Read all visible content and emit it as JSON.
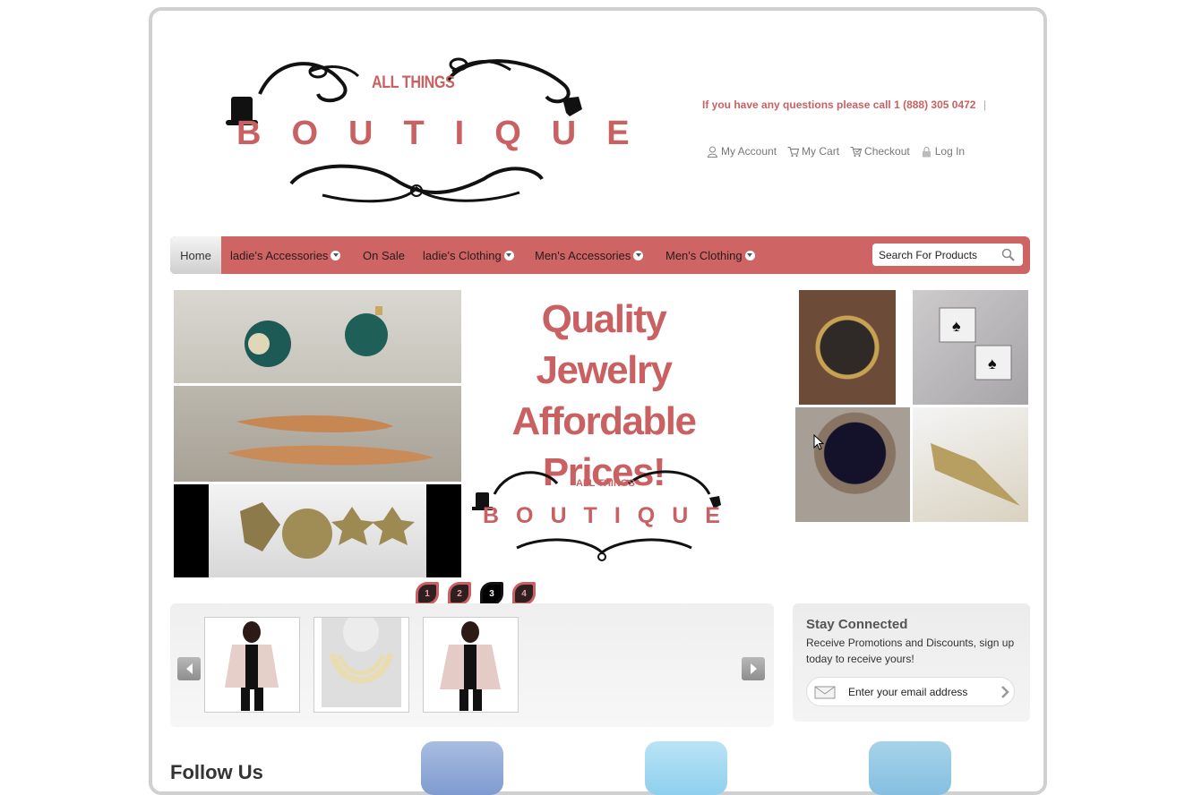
{
  "logo": {
    "small_text": "ALL THINGS",
    "big_text": "BOUTIQUE"
  },
  "header": {
    "phone_text": "If you have any questions please call 1 (888) 305 0472",
    "separator": "|",
    "links": [
      {
        "label": "My Account",
        "icon": "user-icon"
      },
      {
        "label": "My Cart",
        "icon": "cart-icon"
      },
      {
        "label": "Checkout",
        "icon": "checkout-icon"
      },
      {
        "label": "Log In",
        "icon": "lock-icon"
      }
    ]
  },
  "nav": {
    "items": [
      {
        "label": "Home",
        "dropdown": false
      },
      {
        "label": "ladie's Accessories",
        "dropdown": true
      },
      {
        "label": "On Sale",
        "dropdown": false
      },
      {
        "label": "ladie's Clothing",
        "dropdown": true
      },
      {
        "label": "Men's Accessories",
        "dropdown": true
      },
      {
        "label": "Men's Clothing",
        "dropdown": true
      }
    ],
    "search_placeholder": "Search For Products"
  },
  "slider": {
    "headline_lines": [
      "Quality Jewelry",
      "Affordable",
      "Prices!"
    ],
    "logo_small": "ALL THINGS",
    "logo_big": "BOUTIQUE",
    "pages": [
      "1",
      "2",
      "3",
      "4"
    ],
    "active_page": "3"
  },
  "carousel": {
    "products": [
      "cardigan-product",
      "necklace-product",
      "cardigan-product-2"
    ]
  },
  "newsletter": {
    "heading": "Stay Connected",
    "text": "Receive Promotions and Discounts, sign up today to receive yours!",
    "email_placeholder": "Enter your email address"
  },
  "footer": {
    "follow_text": "Follow Us"
  },
  "colors": {
    "brand": "#cf6464",
    "text_pink": "#c96163"
  }
}
